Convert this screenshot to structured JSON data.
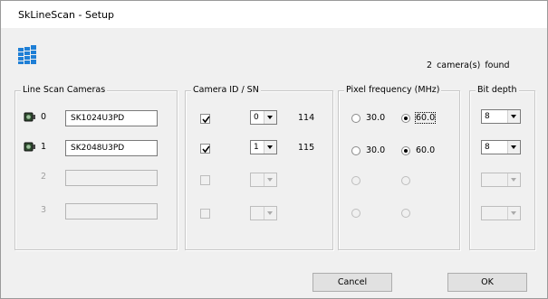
{
  "window": {
    "title": "SkLineScan - Setup"
  },
  "status": {
    "cameras_found": "2  camera(s) found"
  },
  "groups": {
    "cameras": "Line Scan Cameras",
    "camera_id": "Camera ID / SN",
    "pixel_freq": "Pixel frequency (MHz)",
    "bit_depth": "Bit depth"
  },
  "cameras": [
    {
      "index": "0",
      "name": "SK1024U3PD",
      "enabled": true,
      "checked": true,
      "id": "0",
      "sn": "114",
      "freq_a": "30.0",
      "freq_b": "60.0",
      "freq_selected": "b",
      "bit_depth": "8"
    },
    {
      "index": "1",
      "name": "SK2048U3PD",
      "enabled": true,
      "checked": true,
      "id": "1",
      "sn": "115",
      "freq_a": "30.0",
      "freq_b": "60.0",
      "freq_selected": "b",
      "bit_depth": "8"
    },
    {
      "index": "2",
      "name": "",
      "enabled": false,
      "checked": false,
      "id": "",
      "sn": "",
      "freq_a": "",
      "freq_b": "",
      "freq_selected": "",
      "bit_depth": ""
    },
    {
      "index": "3",
      "name": "",
      "enabled": false,
      "checked": false,
      "id": "",
      "sn": "",
      "freq_a": "",
      "freq_b": "",
      "freq_selected": "",
      "bit_depth": ""
    }
  ],
  "buttons": {
    "cancel": "Cancel",
    "ok": "OK"
  },
  "colors": {
    "app_icon_blue": "#1e7fd6"
  }
}
